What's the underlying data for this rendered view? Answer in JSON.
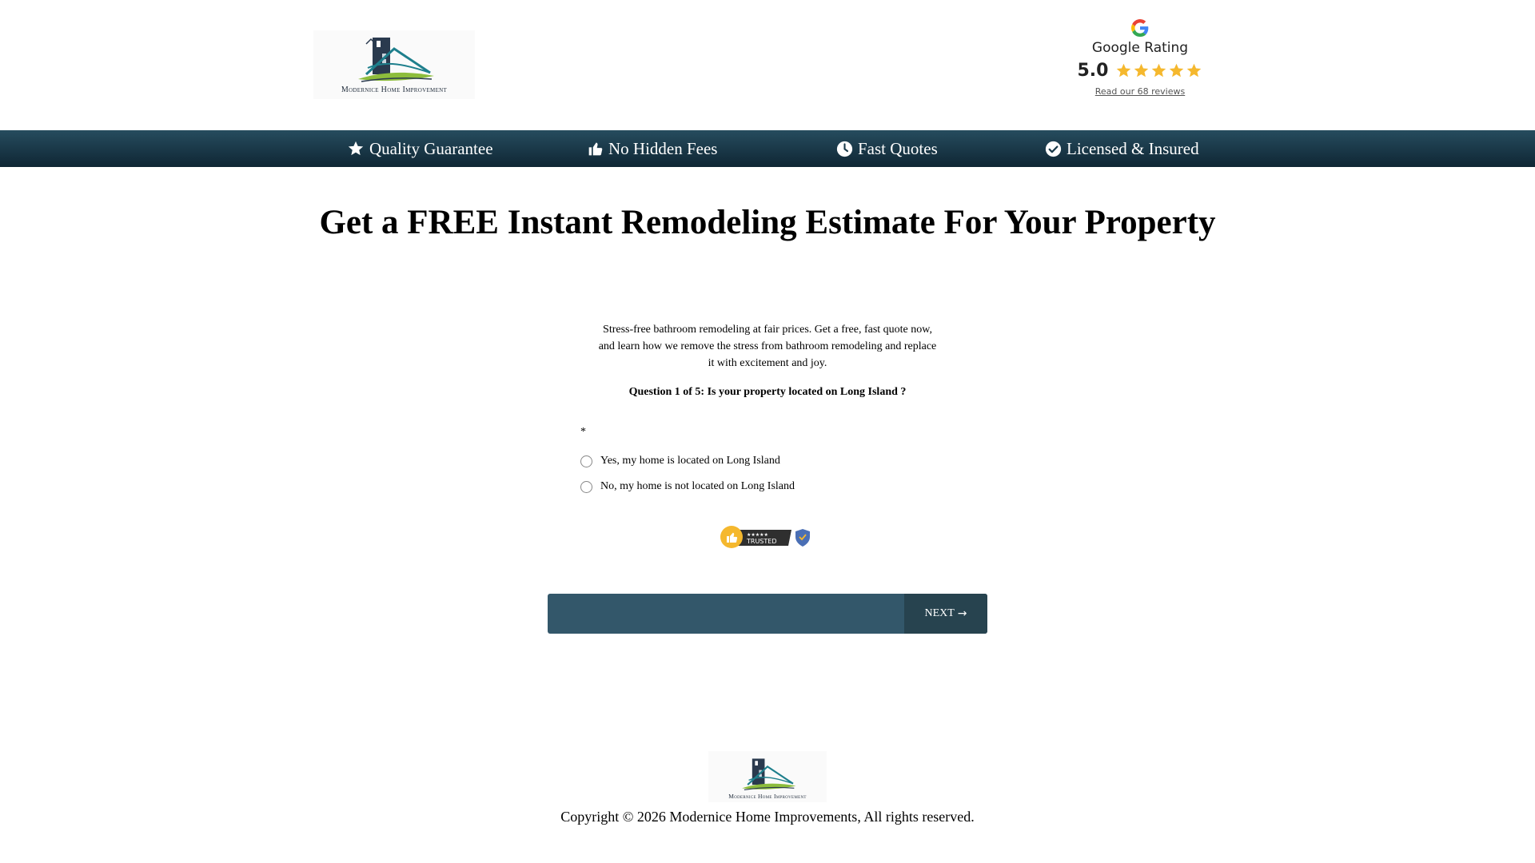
{
  "brand": {
    "logo_text": "Modernice Home Improvement"
  },
  "google_rating": {
    "title": "Google Rating",
    "score": "5.0",
    "stars": 5,
    "reviews_link": "Read our 68 reviews"
  },
  "nav": {
    "items": [
      {
        "label": "Quality Guarantee",
        "icon": "star-icon"
      },
      {
        "label": "No Hidden Fees",
        "icon": "thumbs-up-icon"
      },
      {
        "label": "Fast Quotes",
        "icon": "clock-icon"
      },
      {
        "label": "Licensed & Insured",
        "icon": "check-circle-icon"
      }
    ]
  },
  "main": {
    "headline": "Get a FREE Instant Remodeling Estimate For Your Property",
    "intro_lines": [
      "Stress-free bathroom remodeling at fair prices. Get a free, fast quote now,",
      "and learn how we remove the stress from bathroom remodeling and replace",
      "it with excitement and joy."
    ],
    "question": "Question 1 of 5: Is your property located on Long Island ?",
    "required_marker": "*",
    "options": [
      "Yes, my home is located on Long Island",
      "No, my home is not located on Long Island"
    ],
    "trusted_badge": {
      "stars": "★★★★★",
      "label": "TRUSTED"
    },
    "next_label": "NEXT"
  },
  "footer": {
    "logo_text": "Modernice Home Improvement",
    "copyright": "Copyright © 2026  Modernice Home Improvements, All rights reserved."
  },
  "colors": {
    "nav_band_top": "#264c5e",
    "nav_band_bottom": "#0f2634",
    "next_bar": "#33576a",
    "next_button": "#27434f",
    "star_gold": "#f5b82e"
  }
}
